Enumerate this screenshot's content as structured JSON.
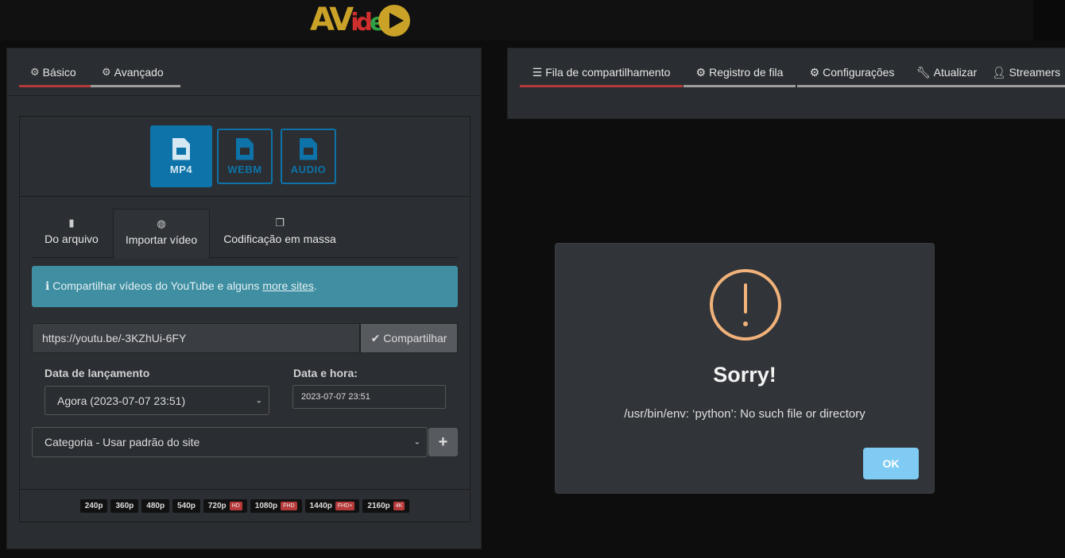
{
  "brand": {
    "logo_part1": "AV",
    "logo_part2": "id",
    "logo_part3": "e"
  },
  "left_panel": {
    "tabs": [
      {
        "icon": "gear-icon",
        "label": "Básico",
        "active": true
      },
      {
        "icon": "gears-icon",
        "label": "Avançado",
        "active": false
      }
    ],
    "formats": [
      {
        "label": "MP4",
        "icon": "file-video-icon",
        "active": true
      },
      {
        "label": "WEBM",
        "icon": "file-video-icon",
        "active": false
      },
      {
        "label": "AUDIO",
        "icon": "file-audio-icon",
        "active": false
      }
    ],
    "subtabs": [
      {
        "label": "Do arquivo",
        "icon": "file-icon"
      },
      {
        "label": "Importar vídeo",
        "icon": "globe-icon",
        "active": true
      },
      {
        "label": "Codificação em massa",
        "icon": "files-icon"
      }
    ],
    "info": {
      "text": "Compartilhar vídeos do YouTube e alguns ",
      "link": "more sites",
      "suffix": "."
    },
    "url_input": {
      "value": "https://youtu.be/-3KZhUi-6FY"
    },
    "share_button": "Compartilhar",
    "release_label": "Data de lançamento",
    "release_value": "Agora (2023-07-07 23:51)",
    "datetime_label": "Data e hora:",
    "datetime_value": "2023-07-07 23:51",
    "category_value": "Categoria - Usar padrão do site",
    "plus": "+",
    "resolutions": [
      {
        "label": "240p",
        "quality": ""
      },
      {
        "label": "360p",
        "quality": ""
      },
      {
        "label": "480p",
        "quality": ""
      },
      {
        "label": "540p",
        "quality": ""
      },
      {
        "label": "720p",
        "quality": "HD"
      },
      {
        "label": "1080p",
        "quality": "FHD"
      },
      {
        "label": "1440p",
        "quality": "FHD+"
      },
      {
        "label": "2160p",
        "quality": "4K"
      }
    ]
  },
  "right_panel": {
    "tabs": [
      {
        "icon": "list-icon",
        "label": "Fila de compartilhamento",
        "active": true
      },
      {
        "icon": "gear-icon",
        "label": "Registro de fila"
      },
      {
        "icon": "gear-icon",
        "label": "Configurações"
      },
      {
        "icon": "wrench-icon",
        "label": "Atualizar"
      },
      {
        "icon": "user-icon",
        "label": "Streamers"
      }
    ]
  },
  "modal": {
    "title": "Sorry!",
    "message": "/usr/bin/env: ‘python’: No such file or directory",
    "ok": "OK"
  },
  "colors": {
    "accent_blue": "#0d73a8",
    "active_tab": "#b23a3a",
    "info_bg": "#3f8ea1",
    "warn": "#f0b27a",
    "ok_btn": "#7fcbf3"
  }
}
